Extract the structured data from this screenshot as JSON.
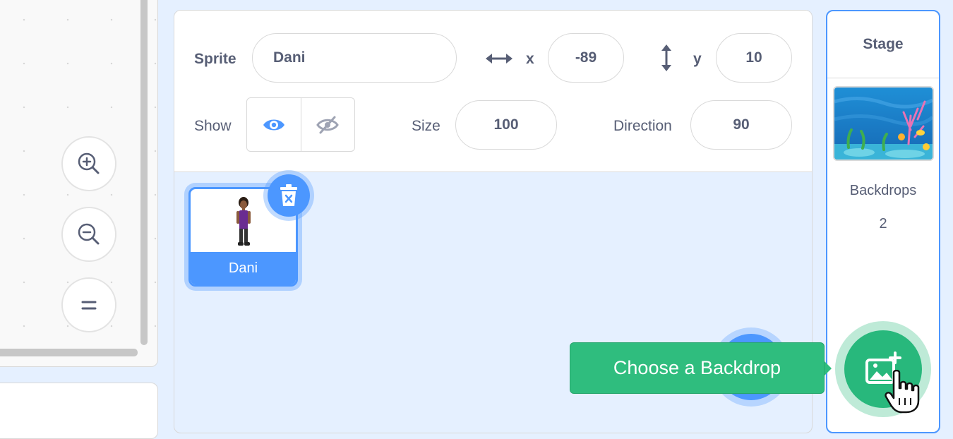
{
  "sprite_info": {
    "sprite_label": "Sprite",
    "sprite_name": "Dani",
    "x_label": "x",
    "x_value": "-89",
    "y_label": "y",
    "y_value": "10",
    "show_label": "Show",
    "size_label": "Size",
    "size_value": "100",
    "direction_label": "Direction",
    "direction_value": "90"
  },
  "sprites": [
    {
      "name": "Dani",
      "selected": true
    }
  ],
  "stage": {
    "title": "Stage",
    "backdrops_label": "Backdrops",
    "backdrops_count": "2"
  },
  "tooltip": {
    "text": "Choose a Backdrop"
  },
  "icons": {
    "zoom_in": "zoom-in-icon",
    "zoom_out": "zoom-out-icon",
    "zoom_reset": "equals-icon",
    "show": "eye-icon",
    "hide": "eye-slash-icon",
    "delete": "trash-icon",
    "backdrop": "image-add-icon",
    "cursor": "hand-pointer-icon"
  },
  "colors": {
    "accent": "#4c97ff",
    "backdrop_button": "#28b87c",
    "tooltip": "#2fbd7e",
    "pane_background": "#e5f0ff",
    "text": "#575e75"
  }
}
